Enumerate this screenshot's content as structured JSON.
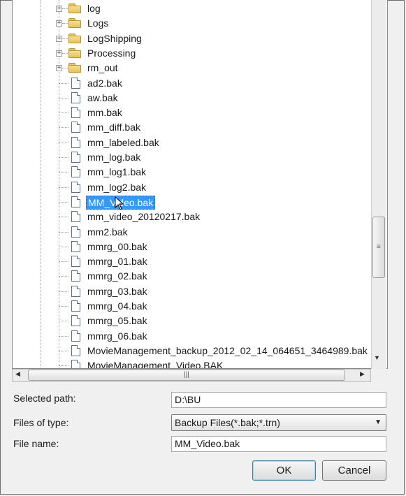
{
  "tree": {
    "items": [
      {
        "label": "log",
        "kind": "folder",
        "expander": "+"
      },
      {
        "label": "Logs",
        "kind": "folder",
        "expander": "+"
      },
      {
        "label": "LogShipping",
        "kind": "folder",
        "expander": "+"
      },
      {
        "label": "Processing",
        "kind": "folder",
        "expander": "+"
      },
      {
        "label": "rm_out",
        "kind": "folder",
        "expander": "+"
      },
      {
        "label": "ad2.bak",
        "kind": "file"
      },
      {
        "label": "aw.bak",
        "kind": "file"
      },
      {
        "label": "mm.bak",
        "kind": "file"
      },
      {
        "label": "mm_diff.bak",
        "kind": "file"
      },
      {
        "label": "mm_labeled.bak",
        "kind": "file"
      },
      {
        "label": "mm_log.bak",
        "kind": "file"
      },
      {
        "label": "mm_log1.bak",
        "kind": "file"
      },
      {
        "label": "mm_log2.bak",
        "kind": "file"
      },
      {
        "label": "MM_Video.bak",
        "kind": "file",
        "selected": true
      },
      {
        "label": "mm_video_20120217.bak",
        "kind": "file"
      },
      {
        "label": "mm2.bak",
        "kind": "file"
      },
      {
        "label": "mmrg_00.bak",
        "kind": "file"
      },
      {
        "label": "mmrg_01.bak",
        "kind": "file"
      },
      {
        "label": "mmrg_02.bak",
        "kind": "file"
      },
      {
        "label": "mmrg_03.bak",
        "kind": "file"
      },
      {
        "label": "mmrg_04.bak",
        "kind": "file"
      },
      {
        "label": "mmrg_05.bak",
        "kind": "file"
      },
      {
        "label": "mmrg_06.bak",
        "kind": "file"
      },
      {
        "label": "MovieManagement_backup_2012_02_14_064651_3464989.bak",
        "kind": "file"
      },
      {
        "label": "MovieManagement_Video.BAK",
        "kind": "file"
      }
    ]
  },
  "form": {
    "selected_path_label": "Selected path:",
    "selected_path_value": "D:\\BU",
    "files_of_type_label": "Files of type:",
    "files_of_type_value": "Backup Files(*.bak;*.trn)",
    "file_name_label": "File name:",
    "file_name_value": "MM_Video.bak"
  },
  "buttons": {
    "ok": "OK",
    "cancel": "Cancel"
  },
  "icons": {
    "folder": "folder-icon",
    "file": "file-icon",
    "expander": "plus-expander-icon",
    "dropdown": "chevron-down-icon"
  },
  "colors": {
    "selection": "#3399ff",
    "folder": "#e7c35d"
  }
}
